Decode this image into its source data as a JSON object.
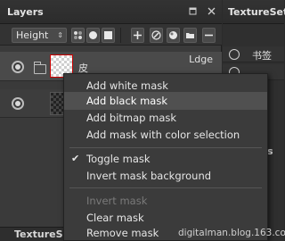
{
  "layers_panel": {
    "title": "Layers",
    "channel": "Height",
    "layers": [
      {
        "name": "皮",
        "blend": "Ldge"
      },
      {
        "name": "",
        "blend": ""
      }
    ],
    "bottom_tab": "TextureSet"
  },
  "texture_set_panel": {
    "title": "TextureSet L",
    "items": [
      {
        "label": "书签"
      },
      {
        "label": ""
      }
    ],
    "mid_label": "s"
  },
  "context_menu": {
    "items": [
      {
        "label": "Add white mask"
      },
      {
        "label": "Add black mask"
      },
      {
        "label": "Add bitmap mask"
      },
      {
        "label": "Add mask with color selection"
      },
      {
        "label": "Toggle mask"
      },
      {
        "label": "Invert mask background"
      },
      {
        "label": "Invert mask"
      },
      {
        "label": "Clear mask"
      },
      {
        "label": "Remove mask"
      }
    ],
    "highlighted": "Add black mask",
    "checked": "Toggle mask",
    "disabled": "Invert mask"
  },
  "watermark": "digitalman.blog.163.com",
  "icons": [
    "pin-icon",
    "close-icon",
    "chevron-down-icon",
    "eye-icon",
    "folder-icon",
    "add-icon",
    "remove-icon",
    "paint-icon",
    "fill-icon",
    "mask-icon",
    "effect-icon",
    "new-folder-icon",
    "check-icon"
  ],
  "colors": {
    "panel_bg": "#3a3a3a",
    "menu_bg": "#3b3b3b",
    "menu_highlight": "#505050",
    "thumb_border_selected": "#cc0000"
  }
}
